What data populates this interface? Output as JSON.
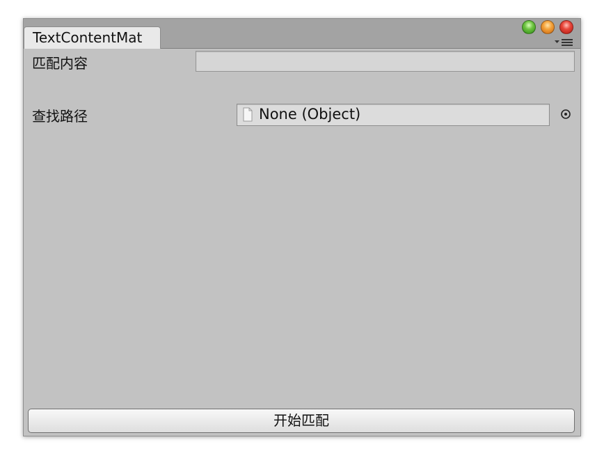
{
  "window": {
    "tab_title": "TextContentMat",
    "controls": [
      "green-zoom-button",
      "orange-minimize-button",
      "red-close-button"
    ],
    "menu_icon": "tab-menu-icon"
  },
  "form": {
    "match_content_label": "匹配内容",
    "match_content_value": "",
    "search_path_label": "查找路径",
    "search_path_value": "None (Object)",
    "object_icon": "document-icon",
    "picker_icon": "object-picker-icon"
  },
  "actions": {
    "start_match_label": "开始匹配"
  },
  "colors": {
    "window_bg": "#c2c2c2",
    "titlebar_bg": "#a3a3a3",
    "tab_bg": "#e9e9e9",
    "button_bg": "#f0f0f0"
  }
}
